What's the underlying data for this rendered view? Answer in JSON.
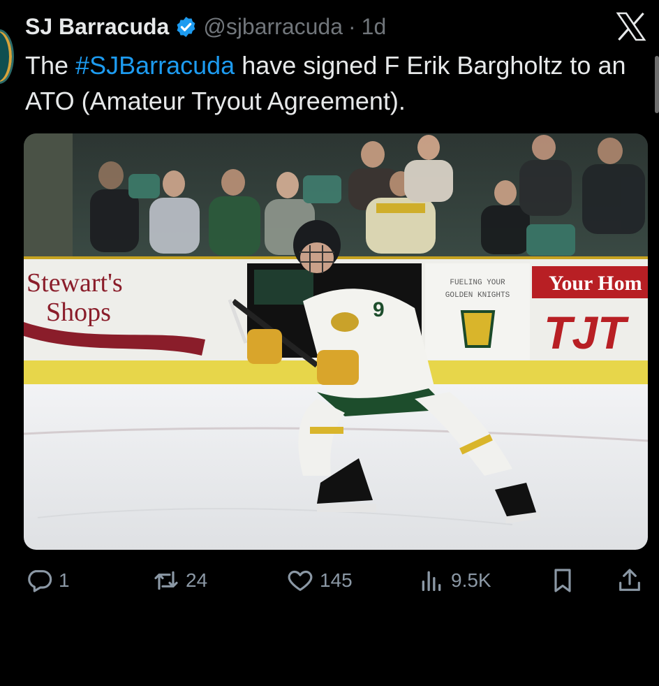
{
  "tweet": {
    "display_name": "SJ Barracuda",
    "handle": "@sjbarracuda",
    "separator": "·",
    "time": "1d",
    "text_before": "The ",
    "hashtag": "#SJBarracuda",
    "text_after": " have signed F Erik Bargholtz to an ATO (Amateur Tryout Agreement).",
    "verified_icon": "verified-badge-icon",
    "brand_color": "#1d9bf0"
  },
  "media": {
    "board_ads": {
      "stewarts_line1": "Stewart's",
      "stewarts_line2": "Shops",
      "fueling_line1": "FUELING YOUR",
      "fueling_line2": "GOLDEN KNIGHTS",
      "your_home": "Your Hom",
      "tj": "TJT"
    },
    "jersey_number": "9"
  },
  "actions": {
    "reply_count": "1",
    "repost_count": "24",
    "like_count": "145",
    "views_count": "9.5K"
  }
}
